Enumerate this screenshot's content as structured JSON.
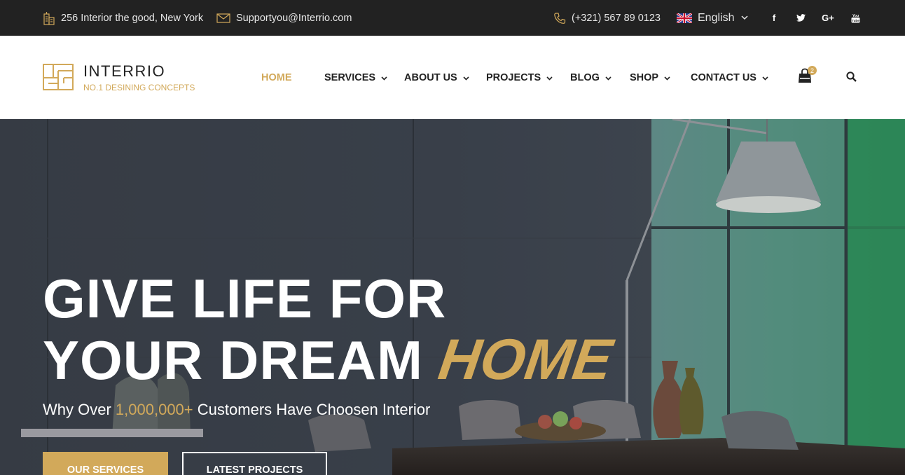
{
  "topbar": {
    "address": "256 Interior the good, New York",
    "email": "Supportyou@Interrio.com",
    "phone": "(+321) 567 89 0123",
    "language": "English",
    "social": [
      "facebook-icon",
      "twitter-icon",
      "google-plus-icon",
      "youtube-icon"
    ],
    "social_glyphs": {
      "facebook": "f",
      "google_plus": "G+"
    }
  },
  "brand": {
    "name": "INTERRIO",
    "tagline": "NO.1 DESINING CONCEPTS",
    "accent_color": "#d2a95a"
  },
  "nav": {
    "items": [
      {
        "label": "HOME",
        "active": true,
        "dropdown": false
      },
      {
        "label": "SERVICES",
        "active": false,
        "dropdown": true
      },
      {
        "label": "ABOUT US",
        "active": false,
        "dropdown": true
      },
      {
        "label": "PROJECTS",
        "active": false,
        "dropdown": true
      },
      {
        "label": "BLOG",
        "active": false,
        "dropdown": true
      },
      {
        "label": "SHOP",
        "active": false,
        "dropdown": true
      },
      {
        "label": "CONTACT US",
        "active": false,
        "dropdown": true
      }
    ],
    "cart_count": "2"
  },
  "hero": {
    "line1": "GIVE LIFE FOR",
    "line2": "YOUR DREAM",
    "accent_word": "HOME",
    "sub_prefix": "Why Over",
    "sub_number": "1,000,000+",
    "sub_suffix": "Customers Have Choosen Interior",
    "primary_button": "OUR SERVICES",
    "secondary_button": "LATEST PROJECTS"
  }
}
